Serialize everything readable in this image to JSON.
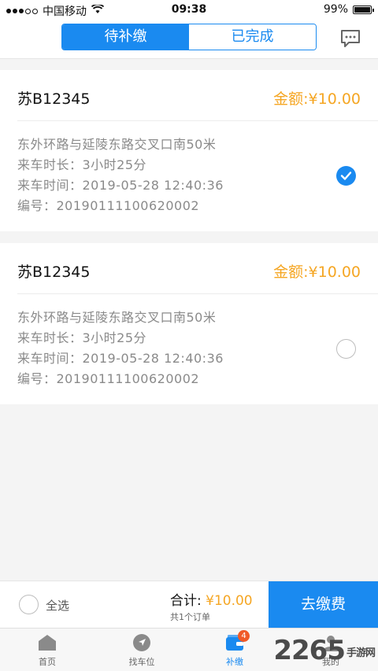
{
  "status_bar": {
    "carrier": "中国移动",
    "time": "09:38",
    "battery": "99%",
    "battery_level": 0.99
  },
  "header": {
    "tabs": [
      {
        "label": "待补缴",
        "active": true
      },
      {
        "label": "已完成",
        "active": false
      }
    ],
    "message_icon": "chat-bubble-icon"
  },
  "orders": [
    {
      "plate": "苏B12345",
      "amount": "金额:¥10.00",
      "location": "东外环路与延陵东路交叉口南50米",
      "duration": "来车时长：3小时25分",
      "time": "来车时间：2019-05-28 12:40:36",
      "number": "编号：20190111100620002",
      "selected": true
    },
    {
      "plate": "苏B12345",
      "amount": "金额:¥10.00",
      "location": "东外环路与延陵东路交叉口南50米",
      "duration": "来车时长：3小时25分",
      "time": "来车时间：2019-05-28 12:40:36",
      "number": "编号：20190111100620002",
      "selected": false
    }
  ],
  "footer": {
    "select_all": "全选",
    "total_label": "合计:",
    "total_value": "¥10.00",
    "order_count": "共1个订单",
    "pay_button": "去缴费"
  },
  "tabbar": {
    "items": [
      {
        "label": "首页",
        "icon": "home-icon"
      },
      {
        "label": "找车位",
        "icon": "navigation-icon"
      },
      {
        "label": "补缴",
        "icon": "wallet-icon",
        "badge": "4",
        "active": true
      },
      {
        "label": "我的",
        "icon": "user-icon"
      }
    ]
  },
  "watermark": {
    "number": "2265",
    "text": "手游网"
  },
  "colors": {
    "accent": "#1a8af0",
    "amount": "#f5a623",
    "badge": "#f05a28"
  }
}
